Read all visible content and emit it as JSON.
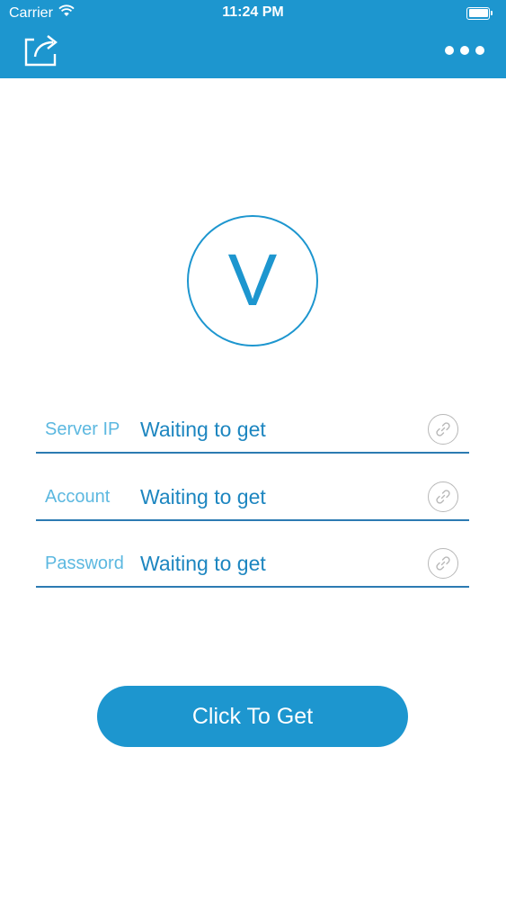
{
  "status_bar": {
    "carrier": "Carrier",
    "time": "11:24 PM",
    "wifi_icon": "wifi-icon",
    "battery_icon": "battery-full-icon"
  },
  "nav_bar": {
    "left_icon": "share-icon",
    "right_icon": "more-dots-icon"
  },
  "logo": {
    "letter": "V"
  },
  "fields": [
    {
      "label": "Server IP",
      "value": "Waiting to get",
      "action_icon": "link-icon"
    },
    {
      "label": "Account",
      "value": "Waiting to get",
      "action_icon": "link-icon"
    },
    {
      "label": "Password",
      "value": "Waiting to get",
      "action_icon": "link-icon"
    }
  ],
  "actions": {
    "get_label": "Click To Get"
  },
  "colors": {
    "primary": "#1d96cf",
    "label": "#5cb8e0",
    "value": "#1d86c0",
    "divider": "#2c7bb2",
    "icon_gray": "#b8b8b8"
  }
}
